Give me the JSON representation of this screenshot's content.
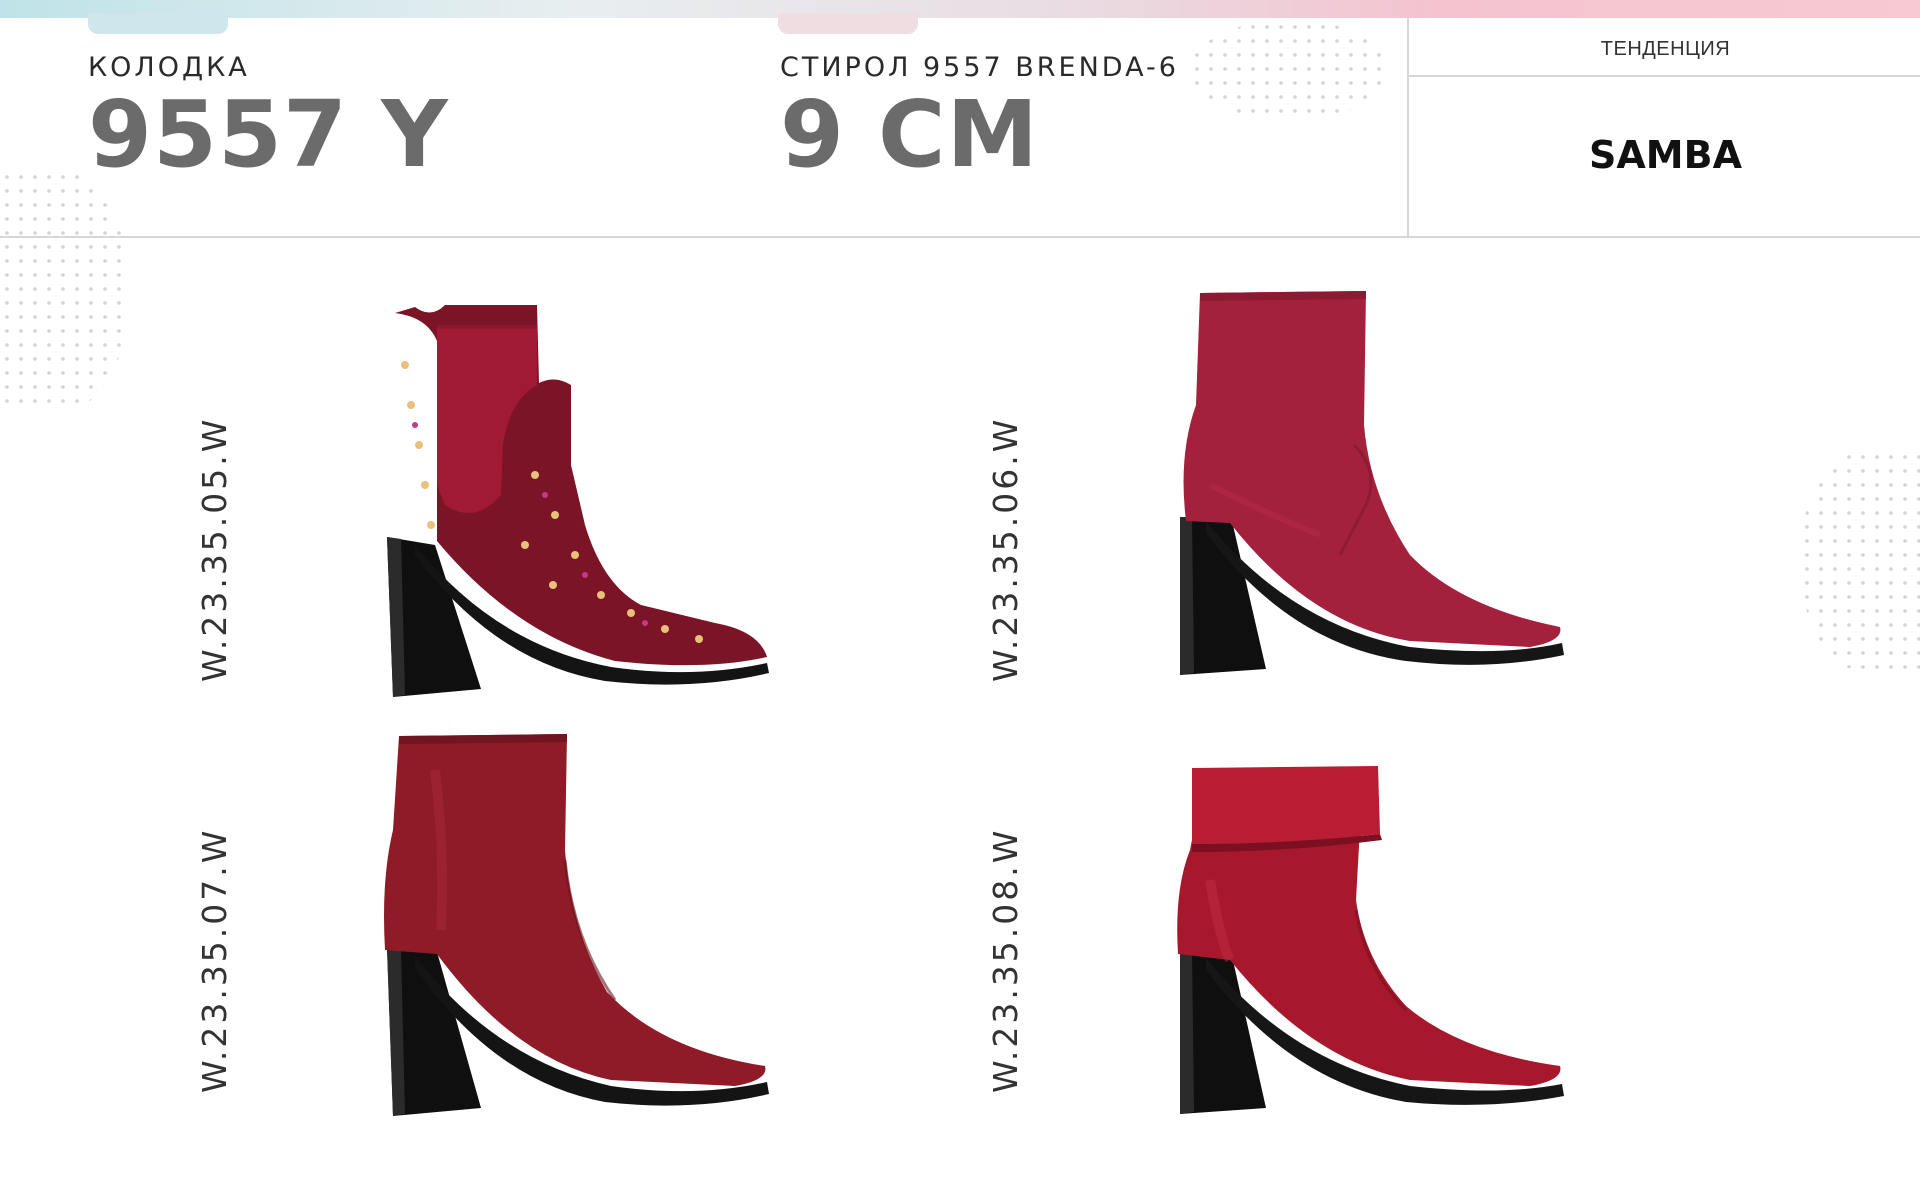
{
  "header": {
    "last_label": "КОЛОДКА",
    "last_value": "9557 Y",
    "heel_label": "СТИРОЛ 9557 BRENDA-6",
    "heel_value": "9 CM",
    "trend_label": "ТЕНДЕНЦИЯ",
    "trend_value": "SAMBA"
  },
  "products": [
    {
      "code": "W.23.35.05.W",
      "material": "velvet-with-studs",
      "color": "#7a1426"
    },
    {
      "code": "W.23.35.06.W",
      "material": "suede",
      "color": "#a3213c"
    },
    {
      "code": "W.23.35.07.W",
      "material": "leather",
      "color": "#8e1b27"
    },
    {
      "code": "W.23.35.08.W",
      "material": "leather-cuff",
      "color": "#a8182d"
    }
  ],
  "colors": {
    "heel": "#111111",
    "header_value": "#6b6b6b",
    "divider": "#d6d6d6"
  }
}
